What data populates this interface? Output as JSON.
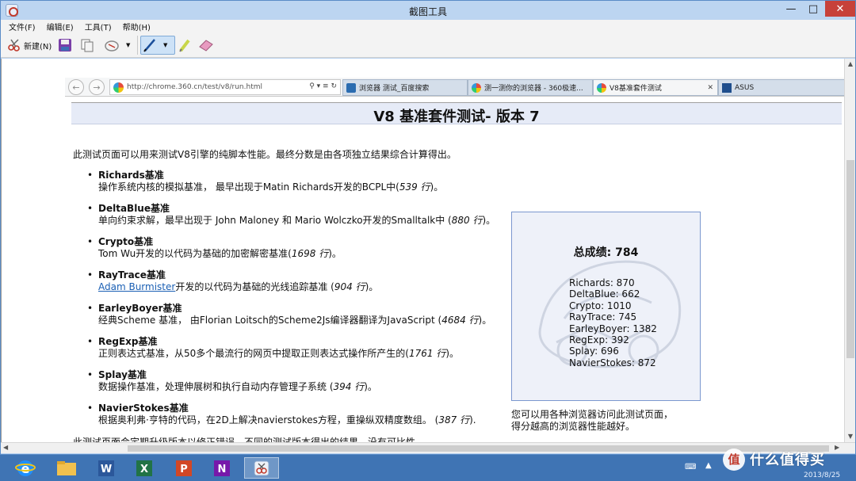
{
  "window": {
    "title": "截图工具",
    "menu": [
      "文件(F)",
      "编辑(E)",
      "工具(T)",
      "帮助(H)"
    ],
    "toolbar": {
      "new_label": "新建(N)"
    }
  },
  "browser": {
    "url": "http://chrome.360.cn/test/v8/run.html",
    "tabs": [
      {
        "label": "浏览器 测试_百度搜索"
      },
      {
        "label": "测一测你的浏览器 - 360极速..."
      },
      {
        "label": "V8基准套件测试"
      },
      {
        "label": "ASUS"
      }
    ]
  },
  "page": {
    "title": "V8 基准套件测试- 版本 7",
    "intro": "此测试页面可以用来测试V8引擎的纯脚本性能。最终分数是由各项独立结果综合计算得出。",
    "benchmarks": [
      {
        "name": "Richards基准",
        "desc_before": "操作系统内核的模拟基准， 最早出现于Matin Richards开发的BCPL中(",
        "lines": "539 行",
        "desc_after": ")。"
      },
      {
        "name": "DeltaBlue基准",
        "desc_before": "单向约束求解，最早出现于 John Maloney 和 Mario Wolczko开发的Smalltalk中 (",
        "lines": "880 行",
        "desc_after": ")。"
      },
      {
        "name": "Crypto基准",
        "desc_before": "Tom Wu开发的以代码为基础的加密解密基准(",
        "lines": "1698 行",
        "desc_after": ")。"
      },
      {
        "name": "RayTrace基准",
        "link": "Adam Burmister",
        "desc_before": "开发的以代码为基础的光线追踪基准 (",
        "lines": "904 行",
        "desc_after": ")。"
      },
      {
        "name": "EarleyBoyer基准",
        "desc_before": "经典Scheme 基准， 由Florian Loitsch的Scheme2Js编译器翻译为JavaScript (",
        "lines": "4684 行",
        "desc_after": ")。"
      },
      {
        "name": "RegExp基准",
        "desc_before": "正则表达式基准，从50多个最流行的网页中提取正则表达式操作所产生的(",
        "lines": "1761 行",
        "desc_after": ")。"
      },
      {
        "name": "Splay基准",
        "desc_before": "数据操作基准，处理伸展树和执行自动内存管理子系统 (",
        "lines": "394 行",
        "desc_after": ")。"
      },
      {
        "name": "NavierStokes基准",
        "desc_before": "根据奥利弗·亨特的代码，在2D上解决navierstokes方程，重操纵双精度数组。 (",
        "lines": "387 行",
        "desc_after": ")."
      }
    ],
    "footnote": "此测试页面会定期升级版本以修正错误，不同的测试版本得出的结果，没有可比性。",
    "score_title": "总成绩: 784",
    "scores": [
      "Richards: 870",
      "DeltaBlue: 662",
      "Crypto: 1010",
      "RayTrace: 745",
      "EarleyBoyer: 1382",
      "RegExp: 392",
      "Splay: 696",
      "NavierStokes: 872"
    ],
    "score_note_1": "您可以用各种浏览器访问此测试页面，",
    "score_note_2": "得分越高的浏览器性能越好。"
  },
  "taskbar": {
    "watermark": "什么值得买",
    "watermark_mark": "值",
    "date": "2013/8/25",
    "word_letter": "W",
    "excel_letter": "X",
    "ppt_letter": "P",
    "onenote_letter": "N"
  }
}
